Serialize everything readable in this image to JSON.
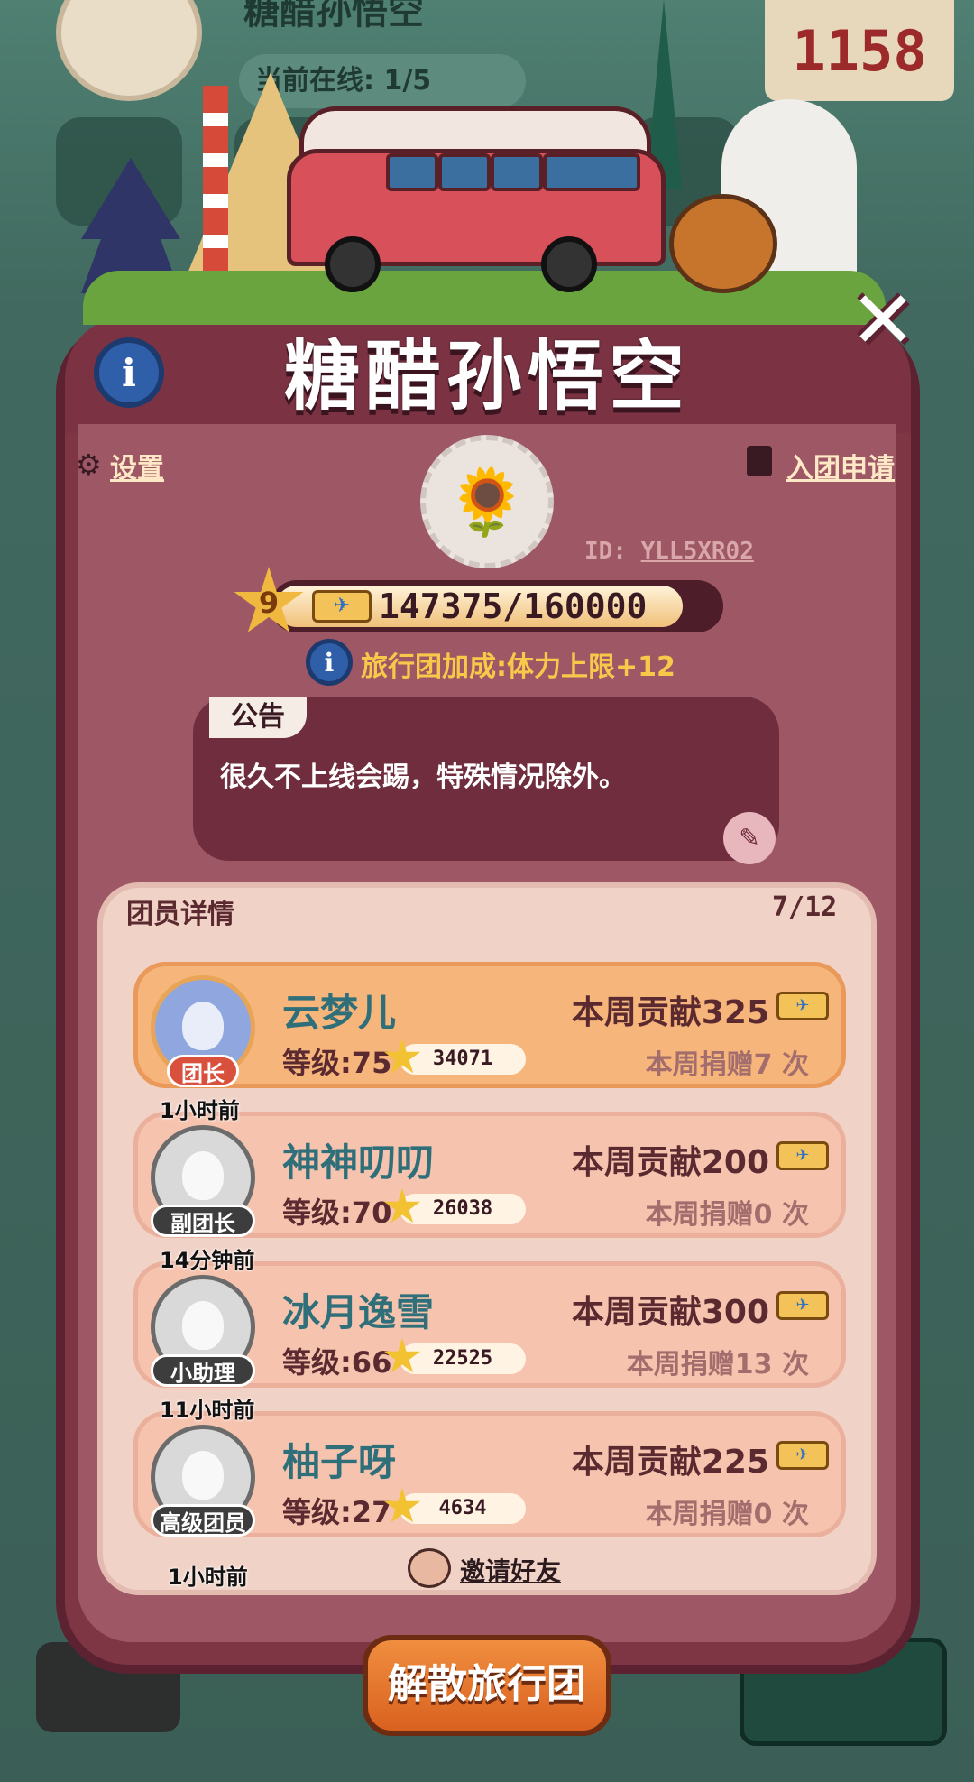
{
  "background": {
    "counter": "1158",
    "online_label": "当前在线: 1/5"
  },
  "team": {
    "name": "糖醋孙悟空",
    "id_label": "ID:",
    "id_value": "YLL5XR02",
    "level": "9",
    "progress_text": "147375/160000",
    "progress_fraction": 0.921,
    "bonus_text": "旅行团加成:体力上限+12"
  },
  "links": {
    "settings": "设置",
    "apply": "入团申请"
  },
  "notice": {
    "tab": "公告",
    "text": "很久不上线会踢，特殊情况除外。"
  },
  "members": {
    "title": "团员详情",
    "count": "7/12",
    "rows": [
      {
        "last_seen": "",
        "role": "团长",
        "name": "云梦儿",
        "level": "等级:75",
        "score": "34071",
        "contribution": "本周贡献325",
        "donation": "本周捐赠7 次"
      },
      {
        "last_seen": "1小时前",
        "role": "副团长",
        "name": "神神叨叨",
        "level": "等级:70",
        "score": "26038",
        "contribution": "本周贡献200",
        "donation": "本周捐赠0 次"
      },
      {
        "last_seen": "14分钟前",
        "role": "小助理",
        "name": "冰月逸雪",
        "level": "等级:66",
        "score": "22525",
        "contribution": "本周贡献300",
        "donation": "本周捐赠13 次"
      },
      {
        "last_seen": "11小时前",
        "role": "高级团员",
        "name": "柚子呀",
        "level": "等级:27",
        "score": "4634",
        "contribution": "本周贡献225",
        "donation": "本周捐赠0 次"
      }
    ],
    "next_last_seen": "1小时前",
    "invite": "邀请好友"
  },
  "actions": {
    "disband": "解散旅行团"
  },
  "icons": {
    "info": "info-icon",
    "close": "close-icon",
    "settings": "gear-icon",
    "apply": "document-edit-icon",
    "ticket": "plane-ticket-icon",
    "star": "star-icon",
    "edit": "pencil-icon",
    "invite": "add-friend-icon"
  },
  "colors": {
    "panel": "#7e3645",
    "panel_body": "#9d5765",
    "leader_row": "#f6b57a",
    "member_row": "#f6c3ae",
    "name_text": "#2f6f7a",
    "bonus_text": "#f7c84a",
    "disband_button": "#e5762f"
  }
}
